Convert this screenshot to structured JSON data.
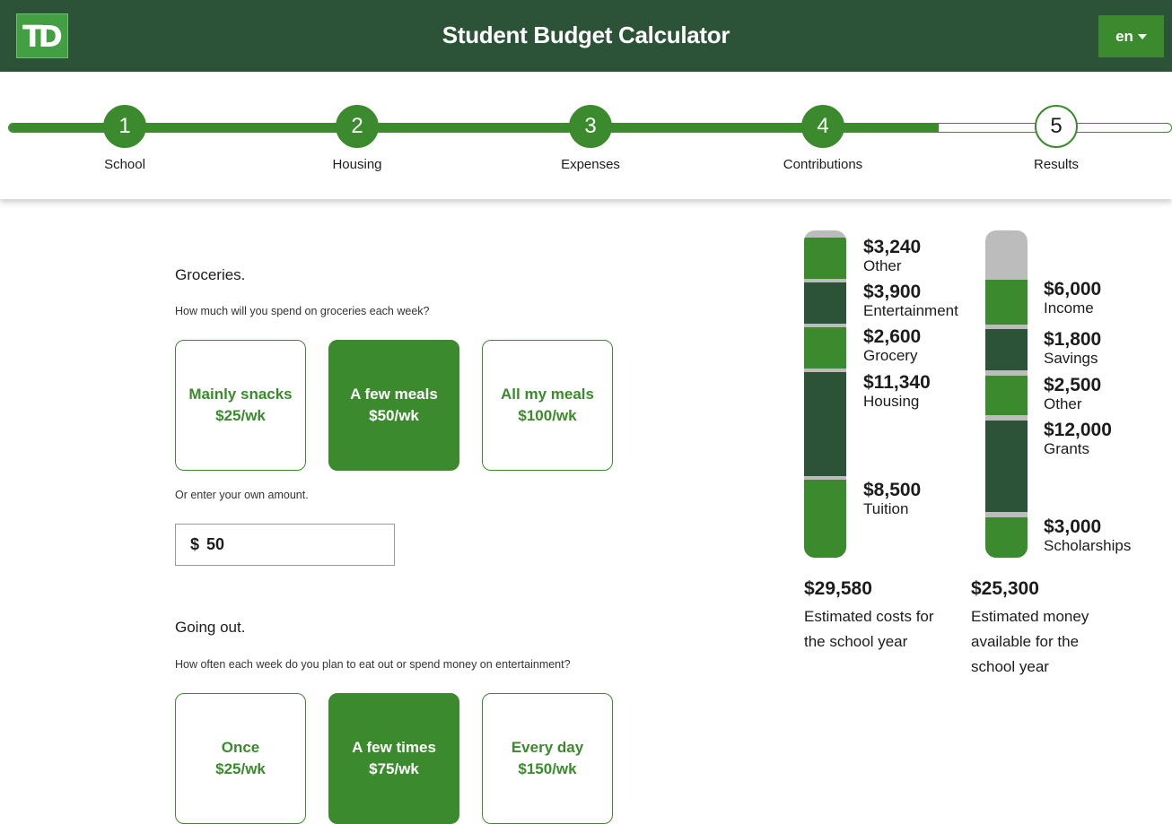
{
  "header": {
    "logo": "TD",
    "title": "Student Budget Calculator",
    "language": "en",
    "accent": "#3b8a2d",
    "dark": "#2c5237"
  },
  "stepper": {
    "progress": 0.8,
    "steps": [
      {
        "number": "1",
        "label": "School",
        "status": "complete"
      },
      {
        "number": "2",
        "label": "Housing",
        "status": "complete"
      },
      {
        "number": "3",
        "label": "Expenses",
        "status": "current"
      },
      {
        "number": "4",
        "label": "Contributions",
        "status": "complete"
      },
      {
        "number": "5",
        "label": "Results",
        "status": "pending"
      }
    ]
  },
  "groceries": {
    "title": "Groceries.",
    "question": "How much will you spend on groceries each week?",
    "options": [
      {
        "label": "Mainly snacks",
        "price": "$25/wk",
        "selected": false
      },
      {
        "label": "A few meals",
        "price": "$50/wk",
        "selected": true
      },
      {
        "label": "All my meals",
        "price": "$100/wk",
        "selected": false
      }
    ],
    "custom_prompt": "Or enter your own amount.",
    "currency": "$",
    "amount": "50"
  },
  "going_out": {
    "title": "Going out.",
    "question": "How often each week do you plan to eat out or spend money on entertainment?",
    "options": [
      {
        "label": "Once",
        "price": "$25/wk",
        "selected": false
      },
      {
        "label": "A few times",
        "price": "$75/wk",
        "selected": true
      },
      {
        "label": "Every day",
        "price": "$150/wk",
        "selected": false
      }
    ]
  },
  "costs": {
    "items": [
      {
        "amount": "$3,240",
        "name": "Other"
      },
      {
        "amount": "$3,900",
        "name": "Entertainment"
      },
      {
        "amount": "$2,600",
        "name": "Grocery"
      },
      {
        "amount": "$11,340",
        "name": "Housing"
      },
      {
        "amount": "$8,500",
        "name": "Tuition"
      }
    ],
    "total": "$29,580",
    "description": "Estimated costs for the school year"
  },
  "money": {
    "items": [
      {
        "amount": "$6,000",
        "name": "Income"
      },
      {
        "amount": "$1,800",
        "name": "Savings"
      },
      {
        "amount": "$2,500",
        "name": "Other"
      },
      {
        "amount": "$12,000",
        "name": "Grants"
      },
      {
        "amount": "$3,000",
        "name": "Scholarships"
      }
    ],
    "total": "$25,300",
    "description": "Estimated money available for the school year"
  }
}
